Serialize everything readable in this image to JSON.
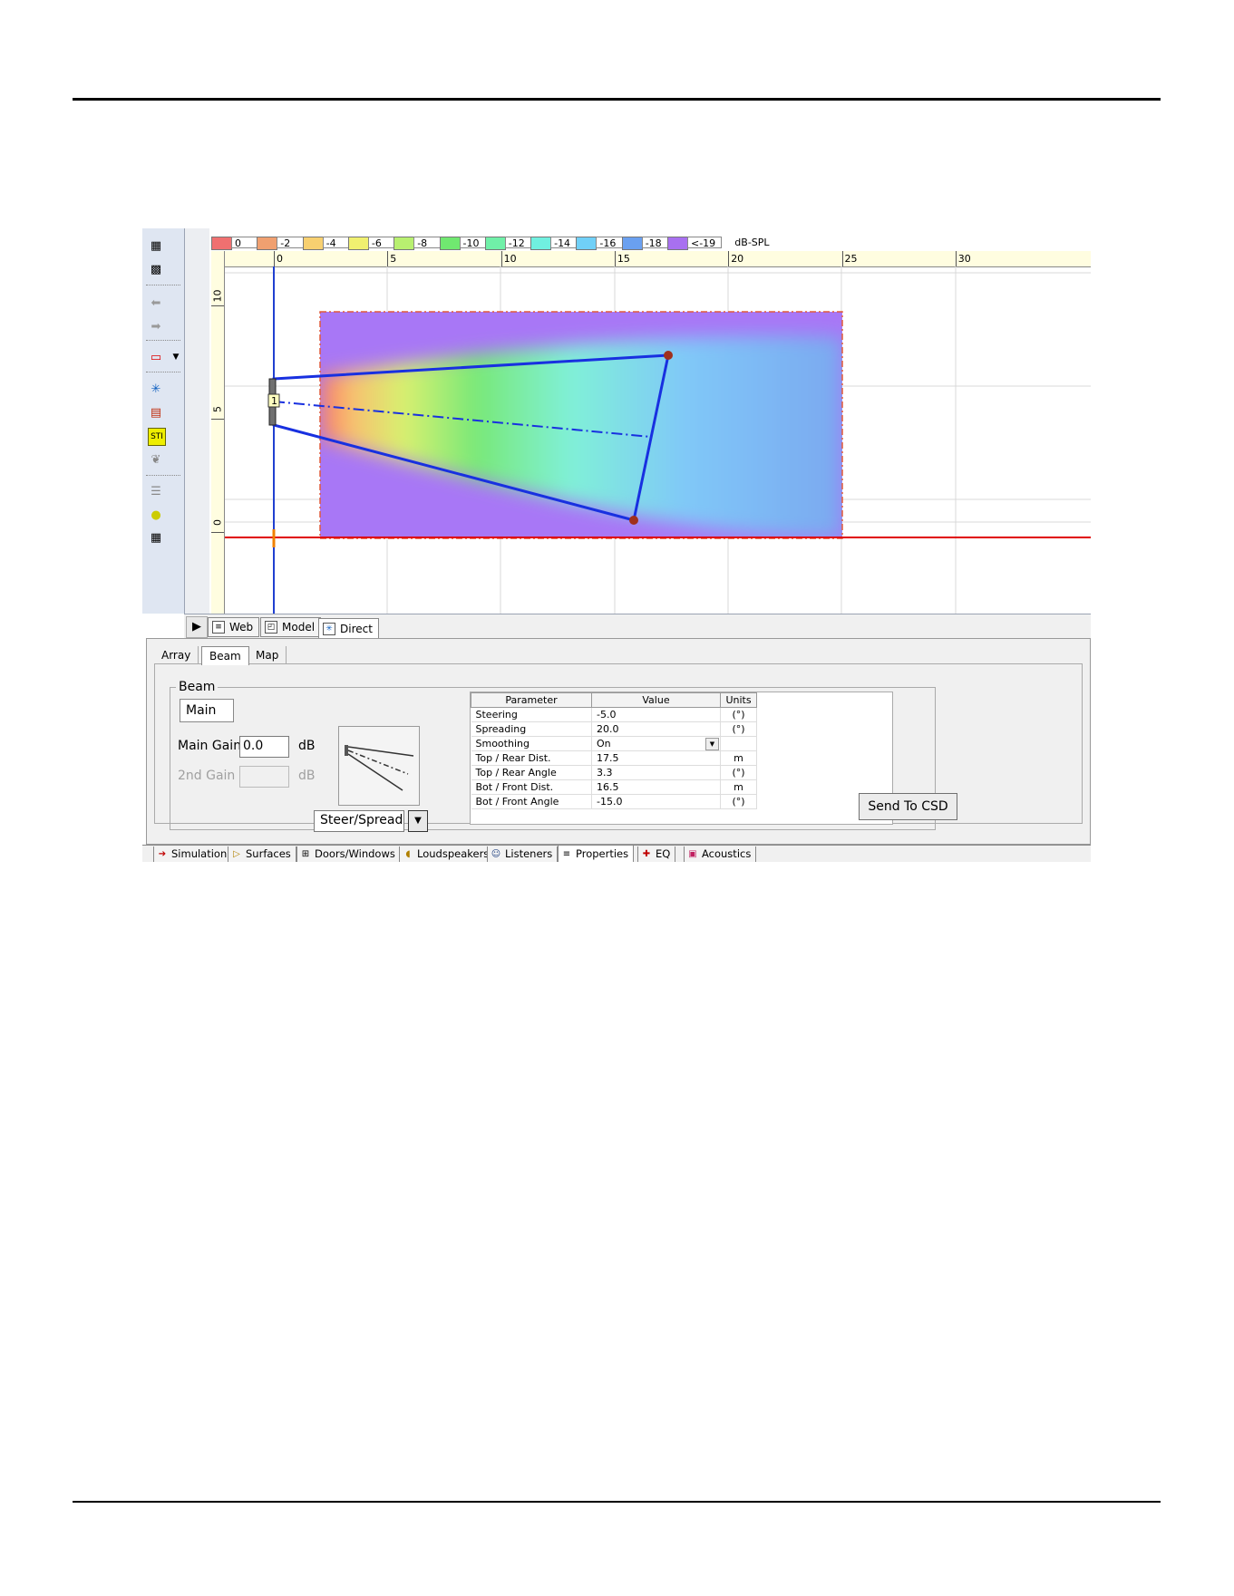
{
  "legend": {
    "steps": [
      {
        "label": "0",
        "color": "#f07070"
      },
      {
        "label": "-2",
        "color": "#f0a070"
      },
      {
        "label": "-4",
        "color": "#f8d070"
      },
      {
        "label": "-6",
        "color": "#f0f070"
      },
      {
        "label": "-8",
        "color": "#b8f070"
      },
      {
        "label": "-10",
        "color": "#70e870"
      },
      {
        "label": "-12",
        "color": "#70f0a8"
      },
      {
        "label": "-14",
        "color": "#70f0e0"
      },
      {
        "label": "-16",
        "color": "#70d0f8"
      },
      {
        "label": "-18",
        "color": "#6aa0f0"
      },
      {
        "label": "<-19",
        "color": "#a870f0"
      }
    ],
    "unit": "dB-SPL"
  },
  "ruler": {
    "x_ticks": [
      "0",
      "5",
      "10",
      "15",
      "20",
      "25",
      "30"
    ],
    "y_ticks": [
      "10",
      "5",
      "0"
    ]
  },
  "speaker_marker": "1",
  "view_tabs": [
    {
      "label": "Web",
      "icon": "document-icon"
    },
    {
      "label": "Model",
      "icon": "model-icon"
    },
    {
      "label": "Direct",
      "icon": "direct-icon"
    }
  ],
  "panel": {
    "tabs": [
      "Array",
      "Beam",
      "Map"
    ],
    "active_tab": "Beam",
    "group_title": "Beam",
    "sub_tab": "Main",
    "main_gain_label": "Main Gain",
    "main_gain_value": "0.0",
    "main_gain_unit": "dB",
    "second_gain_label": "2nd Gain",
    "second_gain_value": "",
    "second_gain_unit": "dB",
    "mode_select": "Steer/Spread",
    "table": {
      "headers": [
        "Parameter",
        "Value",
        "Units"
      ],
      "rows": [
        {
          "param": "Steering",
          "value": "-5.0",
          "unit": "(°)"
        },
        {
          "param": "Spreading",
          "value": "20.0",
          "unit": "(°)"
        },
        {
          "param": "Smoothing",
          "value": "On",
          "unit": ""
        },
        {
          "param": "Top / Rear Dist.",
          "value": "17.5",
          "unit": "m"
        },
        {
          "param": "Top / Rear Angle",
          "value": "3.3",
          "unit": "(°)"
        },
        {
          "param": "Bot / Front Dist.",
          "value": "16.5",
          "unit": "m"
        },
        {
          "param": "Bot / Front Angle",
          "value": "-15.0",
          "unit": "(°)"
        }
      ]
    },
    "send_button": "Send To CSD"
  },
  "bottom_tabs": [
    {
      "label": "Simulation",
      "icon": "arrow-right-icon"
    },
    {
      "label": "Surfaces",
      "icon": "surface-icon"
    },
    {
      "label": "Doors/Windows",
      "icon": "window-icon"
    },
    {
      "label": "Loudspeakers",
      "icon": "speaker-icon"
    },
    {
      "label": "Listeners",
      "icon": "listener-icon"
    },
    {
      "label": "Properties",
      "icon": "document-icon"
    },
    {
      "label": "EQ",
      "icon": "eq-icon"
    },
    {
      "label": "Acoustics",
      "icon": "acoustics-icon"
    }
  ],
  "active_bottom_tab": "Properties"
}
